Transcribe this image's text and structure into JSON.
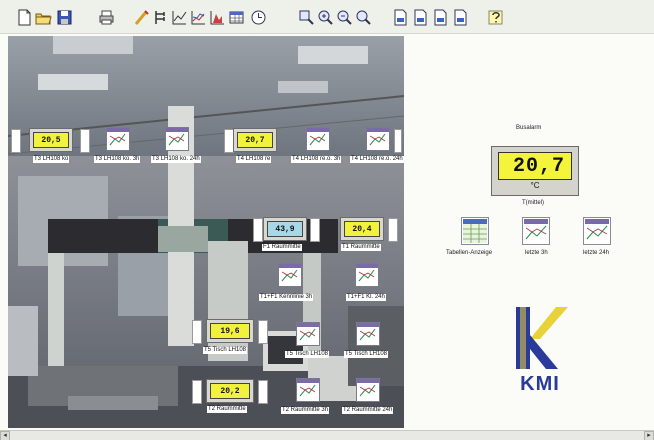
{
  "toolbar": {
    "icons": [
      "new-file-icon",
      "open-folder-icon",
      "save-icon",
      "print-icon",
      "wand-icon",
      "tree-icon",
      "line-chart-icon",
      "area-chart-icon",
      "bar-chart-icon",
      "table-icon",
      "clock-icon",
      "zoom-icon",
      "zoom-in-icon",
      "zoom-out-icon",
      "zoom-fit-icon",
      "doc-a-icon",
      "doc-b-icon",
      "doc-c-icon",
      "doc-d-icon",
      "help-icon"
    ]
  },
  "sensors": [
    {
      "value": "20,5",
      "label": "T3 LH108 ko",
      "style": "yellow"
    },
    {
      "value": "20,7",
      "label": "T4 LH108 re",
      "style": "yellow"
    },
    {
      "value": "43,9",
      "label": "F1 Raummitte",
      "style": "cyan"
    },
    {
      "value": "20,4",
      "label": "T1 Raummitte",
      "style": "yellow"
    },
    {
      "value": "19,6",
      "label": "T5 Tisch LH108",
      "style": "yellow"
    },
    {
      "value": "20,2",
      "label": "T2 Raummitte",
      "style": "yellow"
    }
  ],
  "trend_icons": [
    {
      "label": "T3 LH108 ko. 3h"
    },
    {
      "label": "T3 LH108 ko. 24h"
    },
    {
      "label": "T4 LH108 re.o. 3h"
    },
    {
      "label": "T4 LH108 re.o. 24h"
    },
    {
      "label": "T1+F1 Kennlinie 3h"
    },
    {
      "label": "T1+F1 Kl. 24h"
    },
    {
      "label": "T5 Tisch LH108"
    },
    {
      "label": "T5 Tisch LH108"
    },
    {
      "label": "T2 Raummitte 3h"
    },
    {
      "label": "T2 Raummitte 24h"
    }
  ],
  "right_panel": {
    "alarm_label": "Busalarm",
    "main_value": "20,7",
    "main_unit": "°C",
    "main_label": "T(mittel)",
    "links": [
      {
        "label": "Tabellen-Anzeige",
        "icon": "table-view-icon"
      },
      {
        "label": "letzte 3h",
        "icon": "trend-3h-icon"
      },
      {
        "label": "letzte 24h",
        "icon": "trend-24h-icon"
      }
    ],
    "logo_text": "KMI"
  },
  "colors": {
    "display_yellow": "#f2f23c",
    "display_cyan": "#a8d8e8",
    "logo_blue": "#2a3a9a",
    "logo_yellow": "#e8d23a"
  }
}
